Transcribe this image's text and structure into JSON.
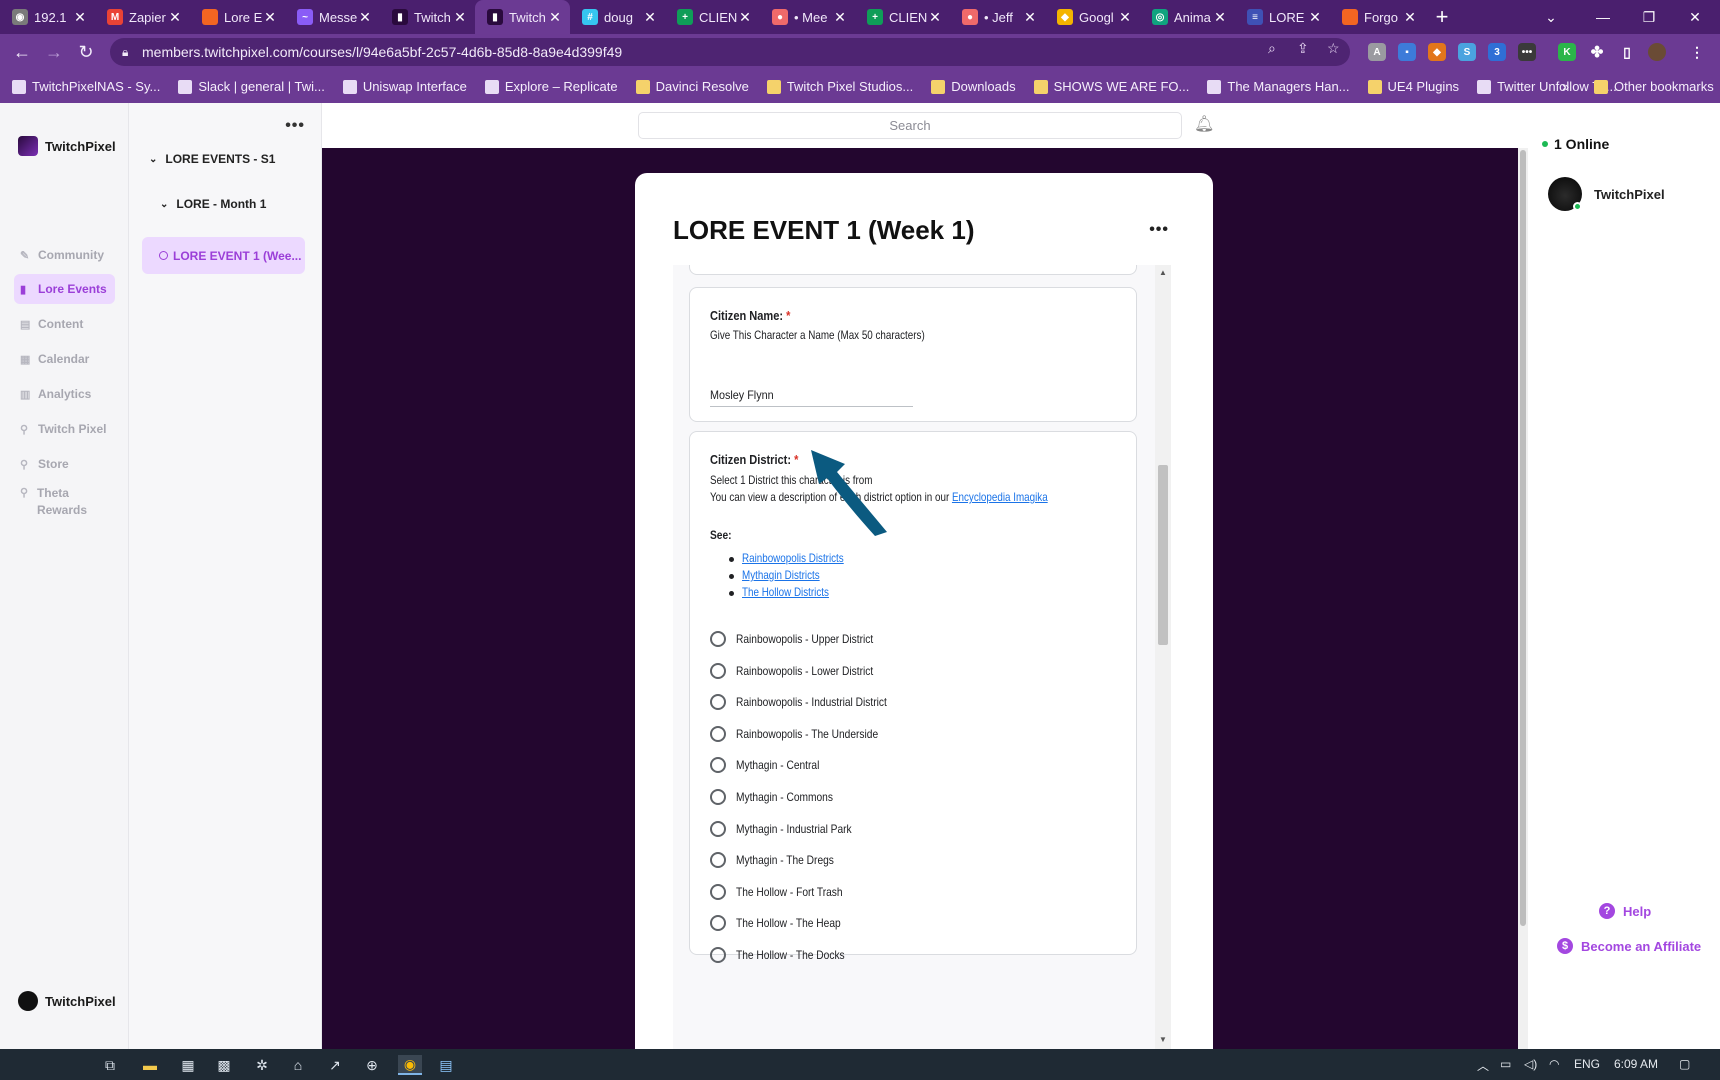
{
  "browser": {
    "tabs": [
      {
        "label": "192.1",
        "color": "#7a7a7a",
        "glyph": "◉"
      },
      {
        "label": "Zapier",
        "color": "#ea4335",
        "glyph": "M"
      },
      {
        "label": "Lore E",
        "color": "#f26522",
        "glyph": ""
      },
      {
        "label": "Messe",
        "color": "#8a5cf6",
        "glyph": "~"
      },
      {
        "label": "Twitch",
        "color": "#2a0a3d",
        "glyph": "▮"
      },
      {
        "label": "Twitch",
        "color": "#2a0a3d",
        "glyph": "▮"
      },
      {
        "label": "doug",
        "color": "#36c5f0",
        "glyph": "#"
      },
      {
        "label": "CLIEN",
        "color": "#0f9d58",
        "glyph": "+"
      },
      {
        "label": "• Mee",
        "color": "#f06a6a",
        "glyph": "●"
      },
      {
        "label": "CLIEN",
        "color": "#0f9d58",
        "glyph": "+"
      },
      {
        "label": "• Jeff",
        "color": "#f06a6a",
        "glyph": "●"
      },
      {
        "label": "Googl",
        "color": "#f4b400",
        "glyph": "◆"
      },
      {
        "label": "Anima",
        "color": "#10a37f",
        "glyph": "◎"
      },
      {
        "label": "LORE",
        "color": "#3f51b5",
        "glyph": "≡"
      },
      {
        "label": "Forgo",
        "color": "#f26522",
        "glyph": ""
      }
    ],
    "active_tab_index": 5,
    "url": "members.twitchpixel.com/courses/l/94e6a5bf-2c57-4d6b-85d8-8a9e4d399f49",
    "bookmarks": [
      {
        "label": "TwitchPixelNAS - Sy...",
        "icon": "dsm",
        "folder": false
      },
      {
        "label": "Slack | general | Twi...",
        "icon": "slack",
        "folder": false
      },
      {
        "label": "Uniswap Interface",
        "icon": "unicorn",
        "folder": false
      },
      {
        "label": "Explore – Replicate",
        "icon": "replicate",
        "folder": false
      },
      {
        "label": "Davinci Resolve",
        "icon": "folder",
        "folder": true
      },
      {
        "label": "Twitch Pixel Studios...",
        "icon": "folder",
        "folder": true
      },
      {
        "label": "Downloads",
        "icon": "folder",
        "folder": true
      },
      {
        "label": "SHOWS WE ARE FO...",
        "icon": "folder",
        "folder": true
      },
      {
        "label": "The Managers Han...",
        "icon": "globe",
        "folder": false
      },
      {
        "label": "UE4 Plugins",
        "icon": "folder",
        "folder": true
      },
      {
        "label": "Twitter Unfollow To...",
        "icon": "globe",
        "folder": false
      }
    ],
    "bookmarks_overflow": "»",
    "other_bookmarks": "Other bookmarks"
  },
  "sidebar": {
    "brand": "TwitchPixel",
    "items": [
      {
        "label": "Community",
        "icon": "pencil-icon",
        "active": false
      },
      {
        "label": "Lore Events",
        "icon": "book-icon",
        "active": true
      },
      {
        "label": "Content",
        "icon": "doc-icon",
        "active": false
      },
      {
        "label": "Calendar",
        "icon": "calendar-icon",
        "active": false
      },
      {
        "label": "Analytics",
        "icon": "chart-icon",
        "active": false
      },
      {
        "label": "Twitch Pixel",
        "icon": "link-icon",
        "active": false
      },
      {
        "label": "Store",
        "icon": "link-icon",
        "active": false
      },
      {
        "label": "Theta Rewards",
        "icon": "link-icon",
        "active": false
      }
    ],
    "footer_user": "TwitchPixel"
  },
  "outline": {
    "menu": "•••",
    "section": "LORE EVENTS - S1",
    "subsection": "LORE - Month 1",
    "lesson": "LORE EVENT 1 (Wee..."
  },
  "topbar": {
    "search_placeholder": "Search"
  },
  "lesson": {
    "title": "LORE EVENT 1 (Week 1)",
    "menu": "•••"
  },
  "form": {
    "name_question": {
      "title": "Citizen Name:",
      "required": "*",
      "description": "Give This Character a Name (Max 50 characters)",
      "answer": "Mosley Flynn"
    },
    "district_question": {
      "title": "Citizen District:",
      "required": "*",
      "line1": "Select 1 District this character is from",
      "line2_prefix": "You can view a description of each district option in our ",
      "line2_link": "Encyclopedia Imagika",
      "see_label": "See:",
      "links": [
        "Rainbowopolis Districts",
        "Mythagin Districts",
        "The Hollow Districts"
      ],
      "options": [
        "Rainbowopolis - Upper District",
        "Rainbowopolis - Lower District",
        "Rainbowopolis - Industrial District",
        "Rainbowopolis - The Underside",
        "Mythagin - Central",
        "Mythagin - Commons",
        "Mythagin - Industrial Park",
        "Mythagin - The Dregs",
        "The Hollow - Fort Trash",
        "The Hollow - The Heap",
        "The Hollow - The Docks"
      ]
    }
  },
  "right_panel": {
    "online": "1 Online",
    "member": "TwitchPixel",
    "help": "Help",
    "affiliate": "Become an Affiliate"
  },
  "taskbar": {
    "lang": "ENG",
    "time": "6:09 AM"
  },
  "annotation": {
    "arrow_color": "#0b5a80"
  }
}
